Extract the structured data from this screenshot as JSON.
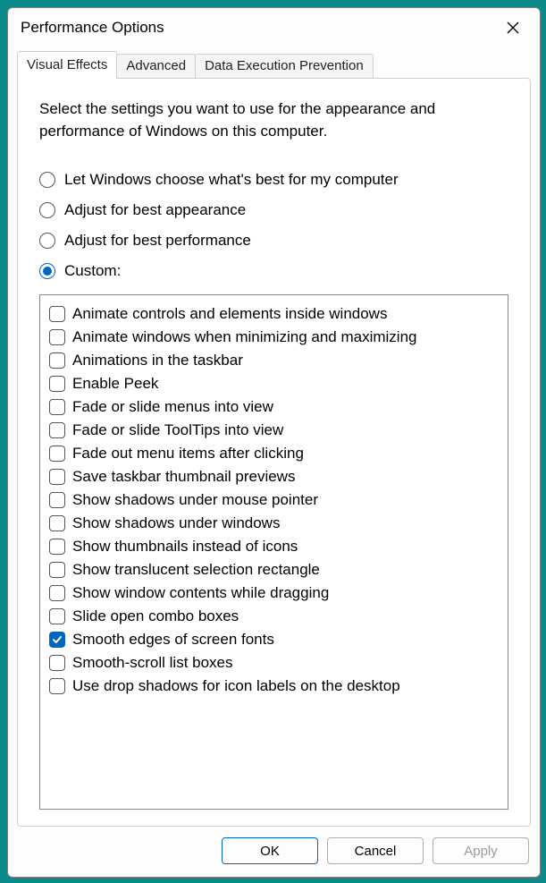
{
  "window": {
    "title": "Performance Options"
  },
  "tabs": [
    {
      "label": "Visual Effects",
      "active": true
    },
    {
      "label": "Advanced",
      "active": false
    },
    {
      "label": "Data Execution Prevention",
      "active": false
    }
  ],
  "intro": "Select the settings you want to use for the appearance and performance of Windows on this computer.",
  "radios": [
    {
      "label": "Let Windows choose what's best for my computer",
      "selected": false
    },
    {
      "label": "Adjust for best appearance",
      "selected": false
    },
    {
      "label": "Adjust for best performance",
      "selected": false
    },
    {
      "label": "Custom:",
      "selected": true
    }
  ],
  "checks": [
    {
      "label": "Animate controls and elements inside windows",
      "checked": false
    },
    {
      "label": "Animate windows when minimizing and maximizing",
      "checked": false
    },
    {
      "label": "Animations in the taskbar",
      "checked": false
    },
    {
      "label": "Enable Peek",
      "checked": false
    },
    {
      "label": "Fade or slide menus into view",
      "checked": false
    },
    {
      "label": "Fade or slide ToolTips into view",
      "checked": false
    },
    {
      "label": "Fade out menu items after clicking",
      "checked": false
    },
    {
      "label": "Save taskbar thumbnail previews",
      "checked": false
    },
    {
      "label": "Show shadows under mouse pointer",
      "checked": false
    },
    {
      "label": "Show shadows under windows",
      "checked": false
    },
    {
      "label": "Show thumbnails instead of icons",
      "checked": false
    },
    {
      "label": "Show translucent selection rectangle",
      "checked": false
    },
    {
      "label": "Show window contents while dragging",
      "checked": false
    },
    {
      "label": "Slide open combo boxes",
      "checked": false
    },
    {
      "label": "Smooth edges of screen fonts",
      "checked": true
    },
    {
      "label": "Smooth-scroll list boxes",
      "checked": false
    },
    {
      "label": "Use drop shadows for icon labels on the desktop",
      "checked": false
    }
  ],
  "buttons": {
    "ok": "OK",
    "cancel": "Cancel",
    "apply": "Apply"
  }
}
